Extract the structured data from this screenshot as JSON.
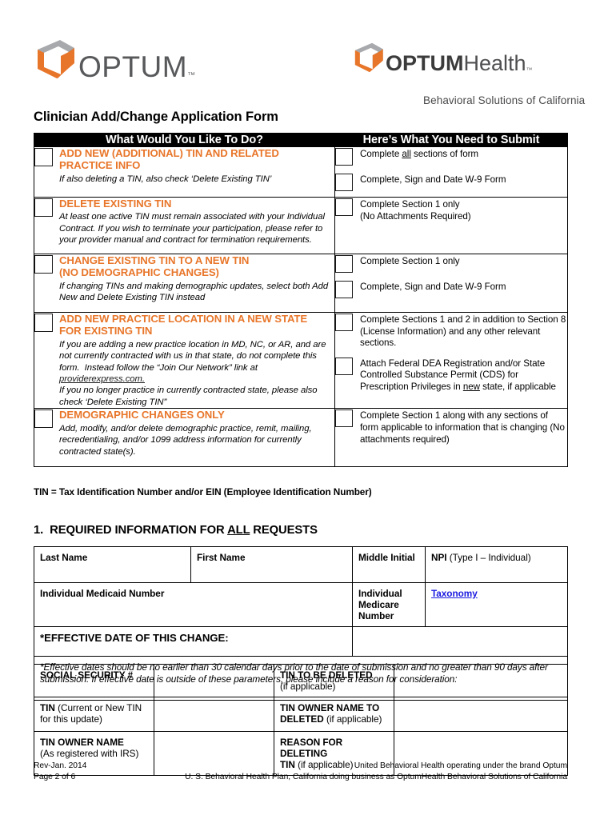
{
  "brand": {
    "accent_orange": "#e8762a",
    "logo_gray": "#58595b",
    "link_blue": "#1a1ae0",
    "left_wordmark": "OPTUM",
    "right_wordmark_bold": "OPTUM",
    "right_wordmark_light": "Health",
    "trademark": "™",
    "tagline": "Behavioral Solutions of California"
  },
  "document": {
    "title": "Clinician Add/Change Application Form"
  },
  "main_table": {
    "headers": {
      "left": "What Would You Like To Do?",
      "right": "Here’s What You Need to Submit"
    },
    "rows": [
      {
        "title": "ADD NEW (ADDITIONAL) TIN AND RELATED PRACTICE INFO",
        "desc": "If also deleting a TIN, also check ‘Delete Existing TIN’",
        "submit": [
          "Complete all sections of form",
          "Complete, Sign and Date W-9 Form"
        ]
      },
      {
        "title": "DELETE EXISTING TIN",
        "desc": "At least one active TIN must remain associated with your Individual Contract.  If you wish to terminate your participation, please refer to your provider manual and contract for termination requirements.",
        "submit": [
          "Complete Section 1 only\n(No Attachments Required)"
        ]
      },
      {
        "title": "CHANGE EXISTING TIN TO A NEW TIN (NO DEMOGRAPHIC CHANGES)",
        "desc": "If changing TINs and making demographic updates, select both Add New and Delete Existing TIN instead",
        "submit": [
          "Complete Section 1 only",
          "Complete, Sign and Date W-9 Form"
        ]
      },
      {
        "title": "ADD NEW PRACTICE LOCATION IN A NEW STATE FOR EXISTING TIN",
        "desc": "If you are adding a new practice location in MD, NC, or AR, and are not currently contracted with us in that state, do not complete this form.  Instead follow the “Join Our Network” link at providerexpress.com. If you no longer practice in currently contracted state, please also check ‘Delete Existing TIN”",
        "link_text": "providerexpress.com.",
        "submit": [
          "Complete Sections 1 and 2 in addition to Section 8 (License Information) and any other relevant sections.",
          "Attach Federal DEA Registration and/or State Controlled Substance Permit (CDS) for Prescription Privileges in new state, if applicable"
        ]
      },
      {
        "title": "DEMOGRAPHIC CHANGES ONLY",
        "desc": "Add, modify, and/or delete demographic practice, remit, mailing, recredentialing, and/or 1099 address information for currently contracted state(s).",
        "submit": [
          "Complete Section 1 along with any sections of form applicable to information that is changing (No attachments required)"
        ]
      }
    ]
  },
  "tin_legend": "TIN = Tax Identification Number and/or EIN (Employee Identification Number)",
  "section1": {
    "heading_prefix": "1.",
    "heading": "REQUIRED INFORMATION FOR ALL REQUESTS",
    "fields": {
      "last_name": "Last Name",
      "first_name": "First Name",
      "middle_initial": "Middle Initial",
      "npi_label": "NPI",
      "npi_note": "(Type I – Individual)",
      "medicaid": "Individual Medicaid Number",
      "medicare": "Individual Medicare Number",
      "taxonomy": "Taxonomy",
      "effective_date": "*EFFECTIVE DATE OF THIS CHANGE:",
      "effective_note": "*Effective dates should be no earlier than 30 calendar days prior to the date of submission and no greater than 90 days after submission.  If effective date is outside of these parameters, please include a reason for consideration:",
      "ssn": "SOCIAL SECURITY #",
      "tin_to_be_deleted": "TIN TO BE DELETED",
      "tin_to_be_deleted_note": "(if applicable)",
      "tin_label": "TIN",
      "tin_note": "(Current or New TIN for this update)",
      "tin_owner_name_to": "TIN OWNER NAME TO",
      "tin_owner_name_deleted": "DELETED",
      "tin_owner_name_deleted_note": "(if applicable)",
      "tin_owner_name": "TIN OWNER NAME",
      "tin_owner_name_note": "(As registered with IRS)",
      "reason_for_deleting": "REASON FOR DELETING",
      "reason_tin": "TIN",
      "reason_note": "(if applicable)"
    }
  },
  "footer": {
    "revision": "Rev-Jan. 2014",
    "page": "Page 2 of 6",
    "line1": "United Behavioral Health operating under the brand Optum",
    "line2": "U. S. Behavioral Health Plan, California doing business as OptumHealth Behavioral Solutions of California"
  }
}
